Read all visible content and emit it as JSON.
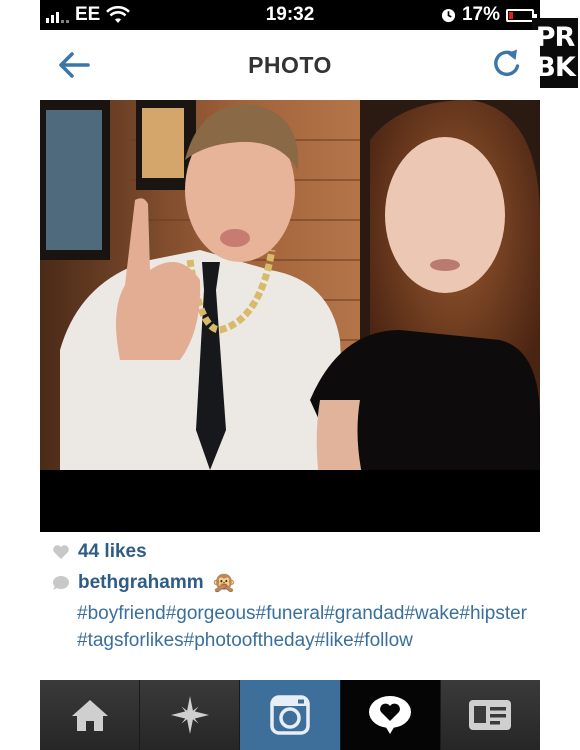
{
  "status_bar": {
    "carrier": "EE",
    "time": "19:32",
    "battery": "17%",
    "battery_level": 0.17,
    "battery_color": "#e0201a"
  },
  "watermark": {
    "line1": "PR",
    "line2": "BK"
  },
  "nav": {
    "title": "PHOTO",
    "back_icon": "arrow-left-icon",
    "refresh_icon": "refresh-icon",
    "accent_color": "#3a77a8"
  },
  "post": {
    "likes": "44 likes",
    "username": "bethgrahamm",
    "emoji": "🙊",
    "caption": "#boyfriend#gorgeous#funeral#grandad#wake#hipster#tagsforlikes#photooftheday#like#follow",
    "link_color": "#2f5c86"
  },
  "tabs": [
    {
      "icon": "home-icon"
    },
    {
      "icon": "explore-star-icon"
    },
    {
      "icon": "camera-icon"
    },
    {
      "icon": "activity-heart-bubble-icon"
    },
    {
      "icon": "profile-card-icon"
    }
  ]
}
